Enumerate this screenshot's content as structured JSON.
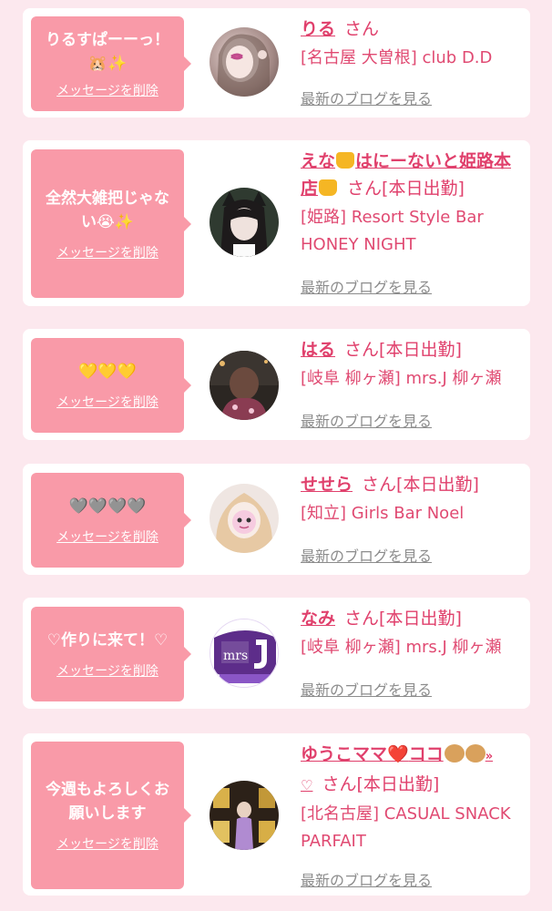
{
  "delete_label": "メッセージを削除",
  "blog_label": "最新のブログを見る",
  "san_label": "さん",
  "cards": [
    {
      "message": "りるすぱーーっ！",
      "message_emoji": "🐹✨",
      "name": "りる",
      "status": "",
      "shop": "[名古屋 大曽根] club D.D"
    },
    {
      "message": "全然大雑把じゃない😭✨",
      "name_part1": "えな",
      "name_part2": "はにーないと姫路本店",
      "name_emoji": "🍯",
      "status": "[本日出勤]",
      "shop": "[姫路] Resort Style Bar HONEY NIGHT"
    },
    {
      "message": "💛💛💛",
      "name": "はる",
      "status": "[本日出勤]",
      "shop": "[岐阜 柳ヶ瀬] mrs.J 柳ヶ瀬"
    },
    {
      "message": "🩶🩶🩶🩶",
      "name": "せせら",
      "status": "[本日出勤]",
      "shop": "[知立] Girls Bar Noel"
    },
    {
      "message": "♡作りに来て！♡",
      "name": "なみ",
      "status": "[本日出勤]",
      "shop": "[岐阜 柳ヶ瀬] mrs.J 柳ヶ瀬"
    },
    {
      "message": "今週もよろしくお願いします",
      "name_part1": "ゆうこママ",
      "name_part2": "ココ",
      "name_heart": "❤️",
      "name_dogs": "🐶🐶",
      "name_tail": "»",
      "name_line2": "♡",
      "status": "[本日出勤]",
      "shop": "[北名古屋] CASUAL SNACK PARFAIT"
    }
  ],
  "colors": {
    "background": "#fce8ee",
    "card": "#ffffff",
    "bubble": "#f99aa8",
    "accent": "#e0406c",
    "blog_link": "#8c8c8c"
  }
}
